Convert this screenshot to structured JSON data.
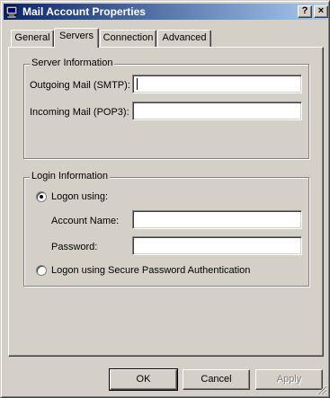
{
  "window": {
    "title": "Mail Account Properties"
  },
  "titlebar_buttons": {
    "help": "?",
    "close": "×"
  },
  "tabs": [
    {
      "label": "General"
    },
    {
      "label": "Servers"
    },
    {
      "label": "Connection"
    },
    {
      "label": "Advanced"
    }
  ],
  "active_tab": "Servers",
  "server_info": {
    "legend": "Server Information",
    "outgoing_label": "Outgoing Mail (SMTP):",
    "outgoing_value": "",
    "incoming_label": "Incoming Mail (POP3):",
    "incoming_value": ""
  },
  "login_info": {
    "legend": "Login Information",
    "logon_using": "Logon using:",
    "account_label": "Account Name:",
    "account_value": "",
    "password_label": "Password:",
    "password_value": "",
    "spa_label": "Logon using Secure Password Authentication",
    "selected": "logon_using"
  },
  "buttons": {
    "ok": "OK",
    "cancel": "Cancel",
    "apply": "Apply"
  }
}
